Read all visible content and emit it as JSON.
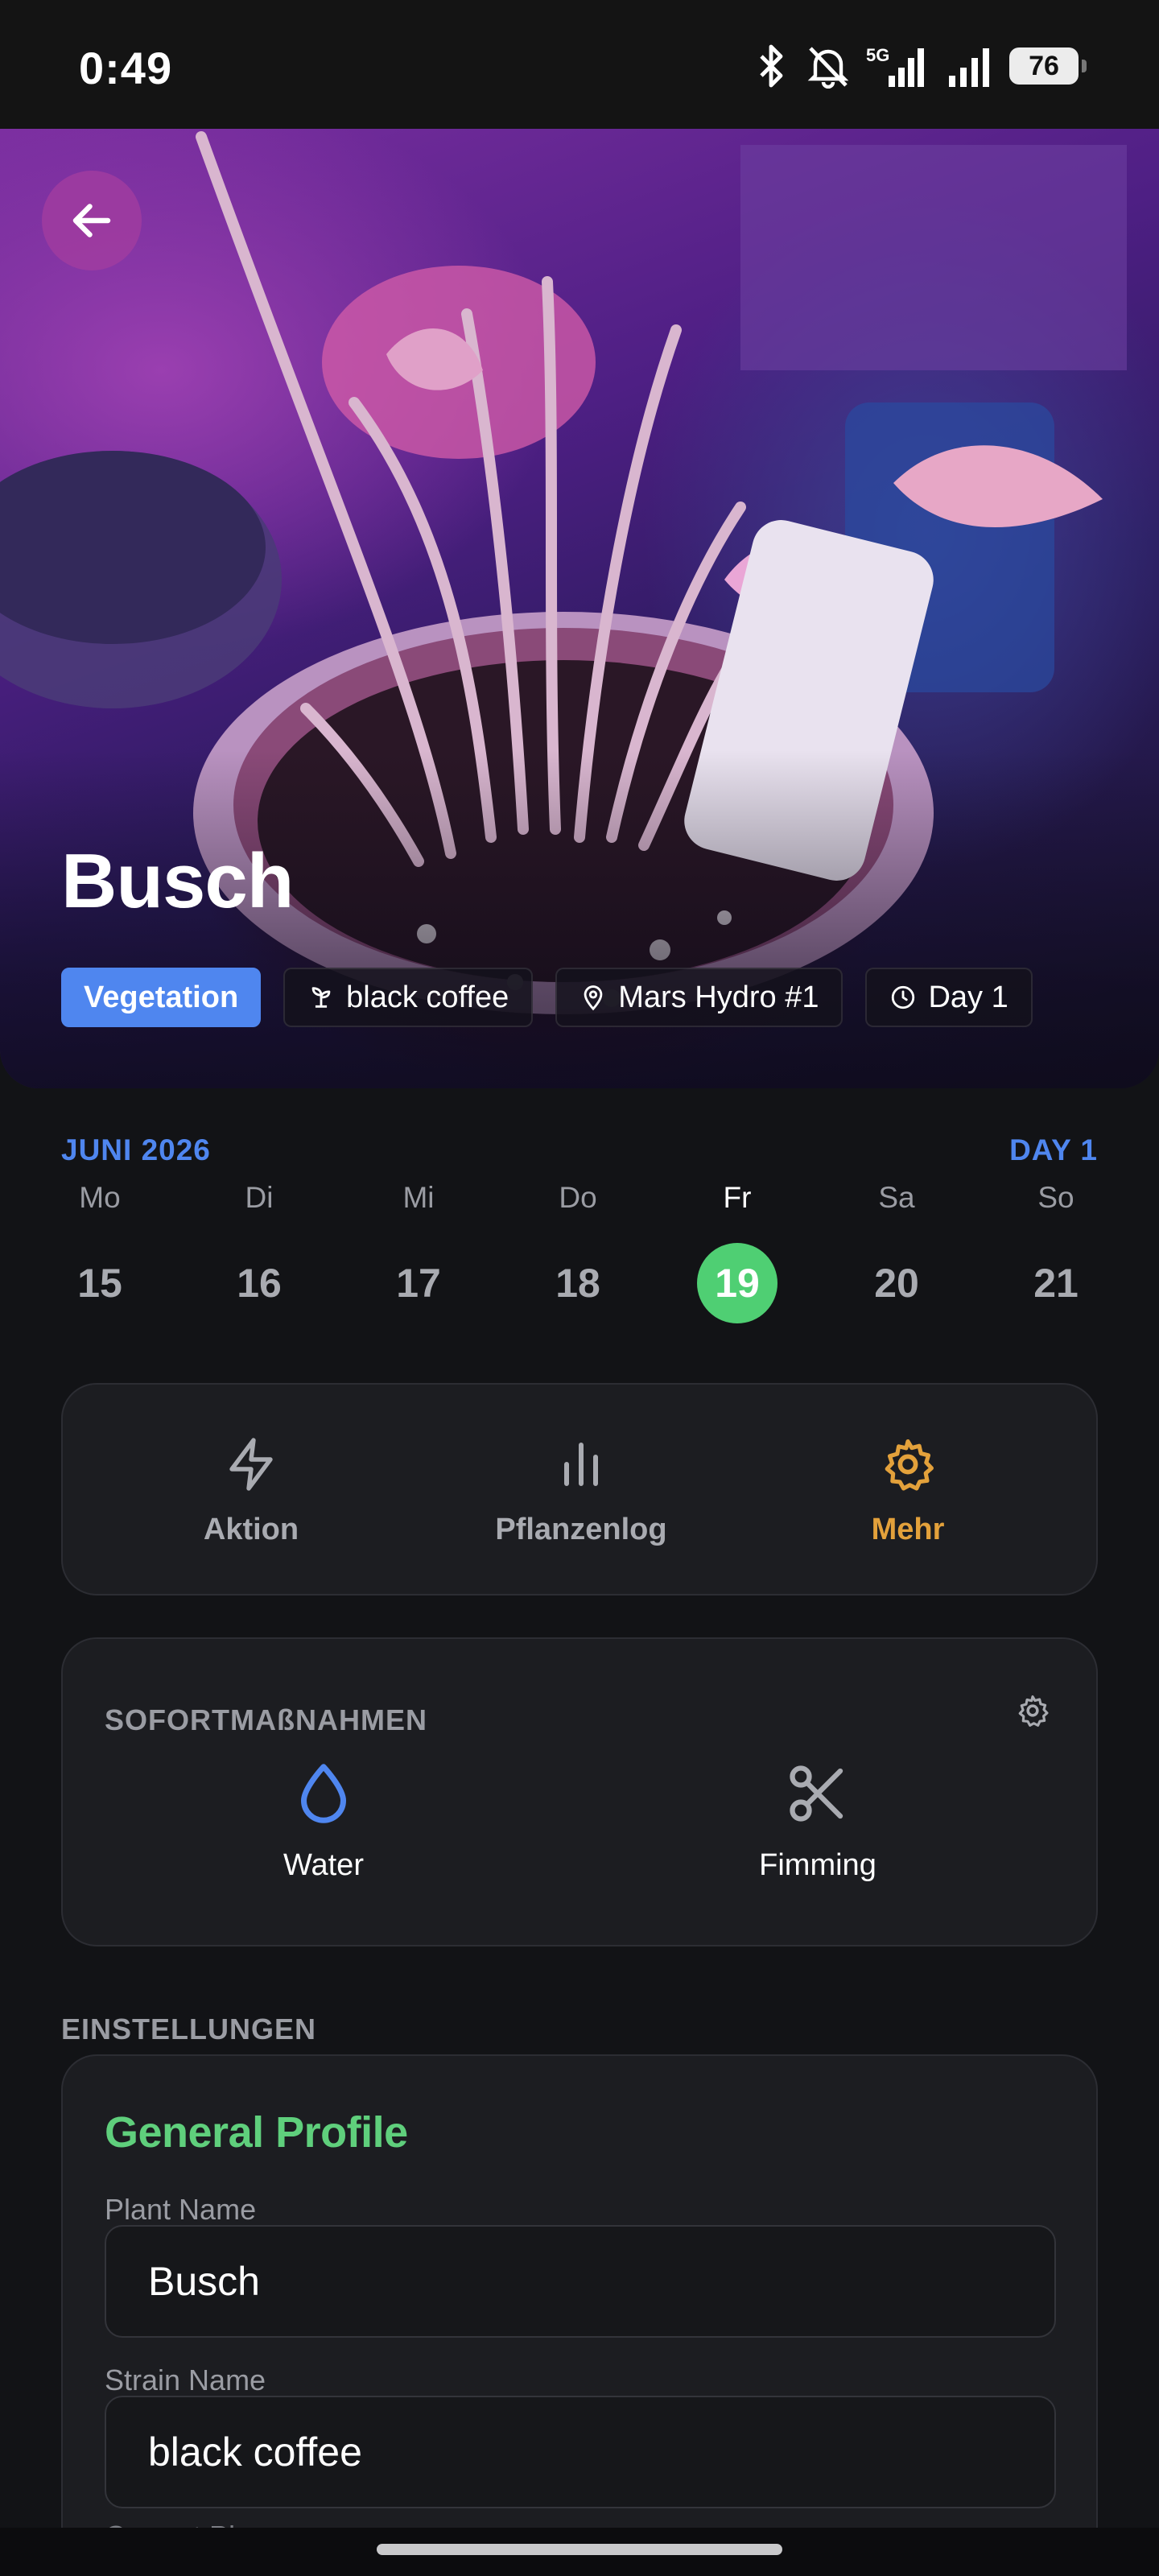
{
  "status_bar": {
    "time": "0:49",
    "battery": "76",
    "network": "5G"
  },
  "hero": {
    "plant_name": "Busch",
    "stage": "Vegetation",
    "strain": "black coffee",
    "location": "Mars Hydro #1",
    "day": "Day 1"
  },
  "calendar": {
    "month": "JUNI 2026",
    "day_label": "DAY 1",
    "days": [
      {
        "name": "Mo",
        "date": "15"
      },
      {
        "name": "Di",
        "date": "16"
      },
      {
        "name": "Mi",
        "date": "17"
      },
      {
        "name": "Do",
        "date": "18"
      },
      {
        "name": "Fr",
        "date": "19"
      },
      {
        "name": "Sa",
        "date": "20"
      },
      {
        "name": "So",
        "date": "21"
      }
    ],
    "selected": "19"
  },
  "tabs": [
    {
      "label": "Aktion",
      "icon": "lightning-icon"
    },
    {
      "label": "Pflanzenlog",
      "icon": "bar-chart-icon"
    },
    {
      "label": "Mehr",
      "icon": "gear-icon"
    }
  ],
  "quick_actions": {
    "title": "SOFORTMAßNAHMEN",
    "items": [
      {
        "label": "Water",
        "icon": "water-drop-icon"
      },
      {
        "label": "Fimming",
        "icon": "scissors-icon"
      }
    ]
  },
  "settings": {
    "section_label": "EINSTELLUNGEN",
    "profile_title": "General Profile",
    "plant_name_label": "Plant Name",
    "plant_name_value": "Busch",
    "strain_name_label": "Strain Name",
    "strain_name_value": "black coffee",
    "next_label_partial": "Current Ph"
  },
  "colors": {
    "accent_blue": "#4f86ef",
    "accent_green": "#4fcf73",
    "accent_orange": "#e3a13b",
    "background": "#121316"
  }
}
